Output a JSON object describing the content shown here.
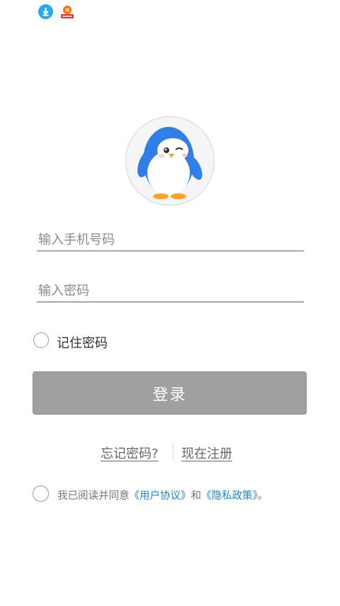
{
  "status_bar": {
    "icons": [
      "download-icon",
      "app-notification-icon"
    ]
  },
  "logo": {
    "icon": "penguin-mascot-logo"
  },
  "phone_input": {
    "placeholder": "输入手机号码",
    "value": ""
  },
  "password_input": {
    "placeholder": "输入密码",
    "value": ""
  },
  "remember": {
    "label": "记住密码",
    "checked": false
  },
  "login_button": {
    "label": "登录"
  },
  "links": {
    "forgot": "忘记密码?",
    "register": "现在注册"
  },
  "agreement": {
    "checked": false,
    "prefix": "我已阅读并同意",
    "user_agreement": "《用户协议》",
    "and": "和",
    "privacy_policy": "《隐私政策》",
    "suffix": "。"
  },
  "colors": {
    "button_disabled": "#a0a0a0",
    "link_blue": "#1e88d6",
    "penguin_blue": "#2f7fe6"
  }
}
